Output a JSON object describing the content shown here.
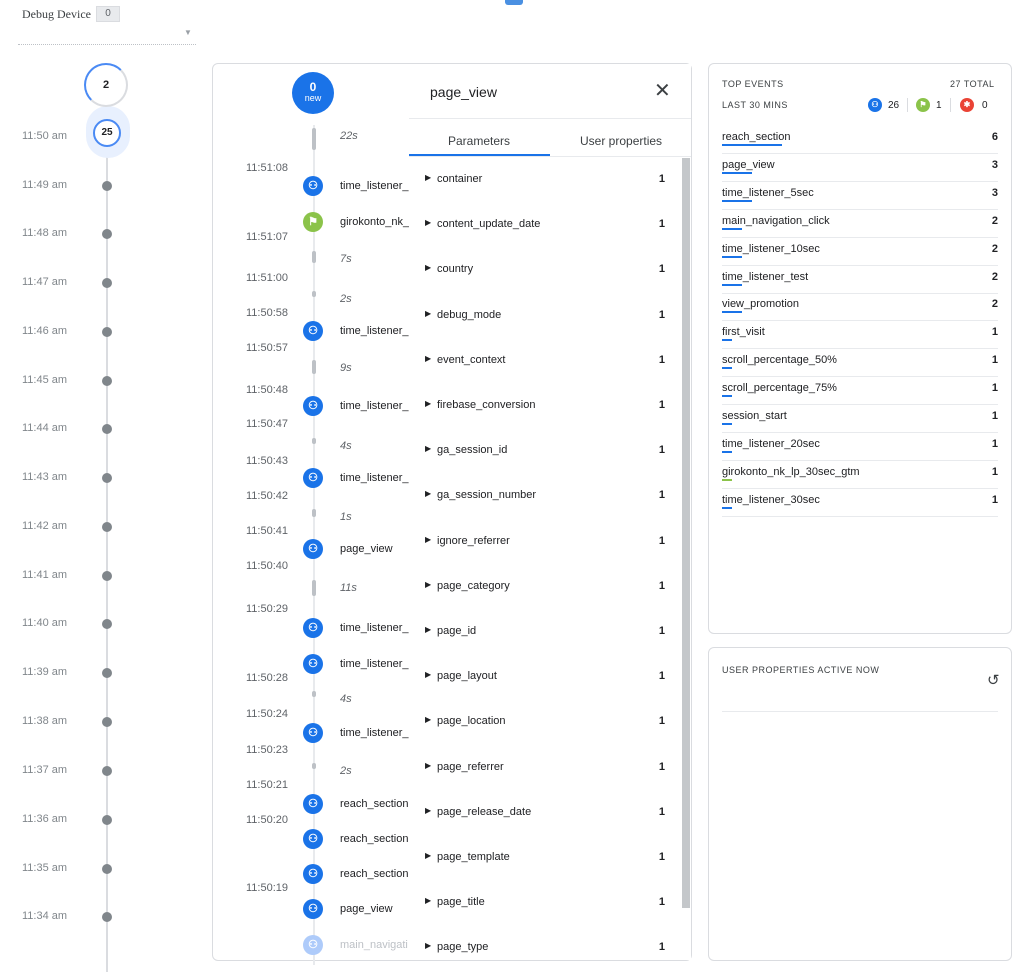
{
  "header": {
    "debug_device_label": "Debug Device",
    "debug_device_count": "0"
  },
  "minutes": {
    "top_count": "2",
    "current_count": "25",
    "labels": [
      "11:50 am",
      "11:49 am",
      "11:48 am",
      "11:47 am",
      "11:46 am",
      "11:45 am",
      "11:44 am",
      "11:43 am",
      "11:42 am",
      "11:41 am",
      "11:40 am",
      "11:39 am",
      "11:38 am",
      "11:37 am",
      "11:36 am",
      "11:35 am",
      "11:34 am"
    ]
  },
  "stream": {
    "new_count": "0",
    "new_label": "new",
    "gaps": [
      "22s",
      "7s",
      "2s",
      "9s",
      "4s",
      "1s",
      "11s",
      "4s",
      "2s"
    ],
    "times": [
      "11:51:08",
      "11:51:07",
      "11:51:00",
      "11:50:58",
      "11:50:57",
      "11:50:48",
      "11:50:47",
      "11:50:43",
      "11:50:42",
      "11:50:41",
      "11:50:40",
      "11:50:29",
      "11:50:28",
      "11:50:24",
      "11:50:23",
      "11:50:21",
      "11:50:20",
      "11:50:19"
    ],
    "events": [
      {
        "name": "time_listener_",
        "type": "blue"
      },
      {
        "name": "girokonto_nk_",
        "type": "green"
      },
      {
        "name": "time_listener_",
        "type": "blue"
      },
      {
        "name": "time_listener_",
        "type": "blue"
      },
      {
        "name": "time_listener_",
        "type": "blue"
      },
      {
        "name": "page_view",
        "type": "blue"
      },
      {
        "name": "time_listener_",
        "type": "blue"
      },
      {
        "name": "time_listener_",
        "type": "blue"
      },
      {
        "name": "time_listener_",
        "type": "blue"
      },
      {
        "name": "reach_section",
        "type": "blue"
      },
      {
        "name": "reach_section",
        "type": "blue"
      },
      {
        "name": "reach_section",
        "type": "blue"
      },
      {
        "name": "page_view",
        "type": "blue"
      },
      {
        "name": "main_navigati",
        "type": "faded"
      }
    ]
  },
  "detail": {
    "title": "page_view",
    "tabs": [
      "Parameters",
      "User properties"
    ],
    "params": [
      {
        "name": "container",
        "count": "1"
      },
      {
        "name": "content_update_date",
        "count": "1"
      },
      {
        "name": "country",
        "count": "1"
      },
      {
        "name": "debug_mode",
        "count": "1"
      },
      {
        "name": "event_context",
        "count": "1"
      },
      {
        "name": "firebase_conversion",
        "count": "1"
      },
      {
        "name": "ga_session_id",
        "count": "1"
      },
      {
        "name": "ga_session_number",
        "count": "1"
      },
      {
        "name": "ignore_referrer",
        "count": "1"
      },
      {
        "name": "page_category",
        "count": "1"
      },
      {
        "name": "page_id",
        "count": "1"
      },
      {
        "name": "page_layout",
        "count": "1"
      },
      {
        "name": "page_location",
        "count": "1"
      },
      {
        "name": "page_referrer",
        "count": "1"
      },
      {
        "name": "page_release_date",
        "count": "1"
      },
      {
        "name": "page_template",
        "count": "1"
      },
      {
        "name": "page_title",
        "count": "1"
      },
      {
        "name": "page_type",
        "count": "1"
      }
    ]
  },
  "top_events": {
    "title": "TOP EVENTS",
    "total": "27 TOTAL",
    "subtitle": "LAST 30 MINS",
    "counts": {
      "blue": "26",
      "green": "1",
      "red": "0"
    },
    "colors": {
      "blue": "#1a73e8",
      "green": "#8bc34a",
      "red": "#ea4335"
    },
    "items": [
      {
        "name": "reach_section",
        "value": 6,
        "bar": "blue"
      },
      {
        "name": "page_view",
        "value": 3,
        "bar": "blue"
      },
      {
        "name": "time_listener_5sec",
        "value": 3,
        "bar": "blue"
      },
      {
        "name": "main_navigation_click",
        "value": 2,
        "bar": "blue"
      },
      {
        "name": "time_listener_10sec",
        "value": 2,
        "bar": "blue"
      },
      {
        "name": "time_listener_test",
        "value": 2,
        "bar": "blue"
      },
      {
        "name": "view_promotion",
        "value": 2,
        "bar": "blue"
      },
      {
        "name": "first_visit",
        "value": 1,
        "bar": "blue"
      },
      {
        "name": "scroll_percentage_50%",
        "value": 1,
        "bar": "blue"
      },
      {
        "name": "scroll_percentage_75%",
        "value": 1,
        "bar": "blue"
      },
      {
        "name": "session_start",
        "value": 1,
        "bar": "blue"
      },
      {
        "name": "time_listener_20sec",
        "value": 1,
        "bar": "blue"
      },
      {
        "name": "girokonto_nk_lp_30sec_gtm",
        "value": 1,
        "bar": "green"
      },
      {
        "name": "time_listener_30sec",
        "value": 1,
        "bar": "blue"
      }
    ]
  },
  "user_properties": {
    "title": "USER PROPERTIES ACTIVE NOW"
  }
}
